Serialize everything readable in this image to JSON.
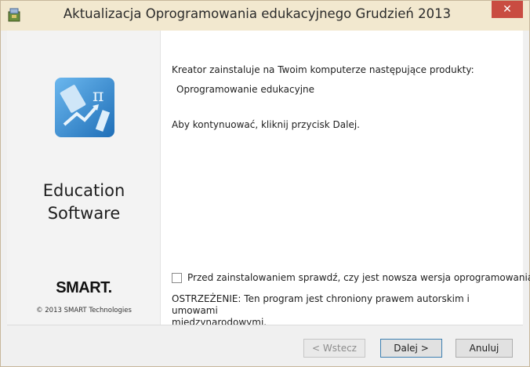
{
  "window": {
    "title": "Aktualizacja Oprogramowania edukacyjnego Grudzień 2013",
    "close_label": "✕"
  },
  "sidebar": {
    "product_name_line1": "Education",
    "product_name_line2": "Software",
    "brand_logo": "SMART.",
    "copyright": "© 2013 SMART Technologies"
  },
  "main": {
    "intro": "Kreator zainstaluje na Twoim komputerze następujące produkty:",
    "product": "Oprogramowanie edukacyjne",
    "instruction": "Aby kontynuować, kliknij przycisk Dalej.",
    "check_updates_label": "Przed zainstalowaniem sprawdź, czy jest nowsza wersja oprogramowania.",
    "check_updates_checked": false,
    "warning_line1": "OSTRZEŻENIE: Ten program jest chroniony prawem autorskim i umowami",
    "warning_line2": "międzynarodowymi."
  },
  "buttons": {
    "back": "< Wstecz",
    "next": "Dalej >",
    "cancel": "Anuluj"
  },
  "colors": {
    "titlebar": "#f2e8cf",
    "close": "#c94c41",
    "icon_blue": "#3a8fd6"
  }
}
